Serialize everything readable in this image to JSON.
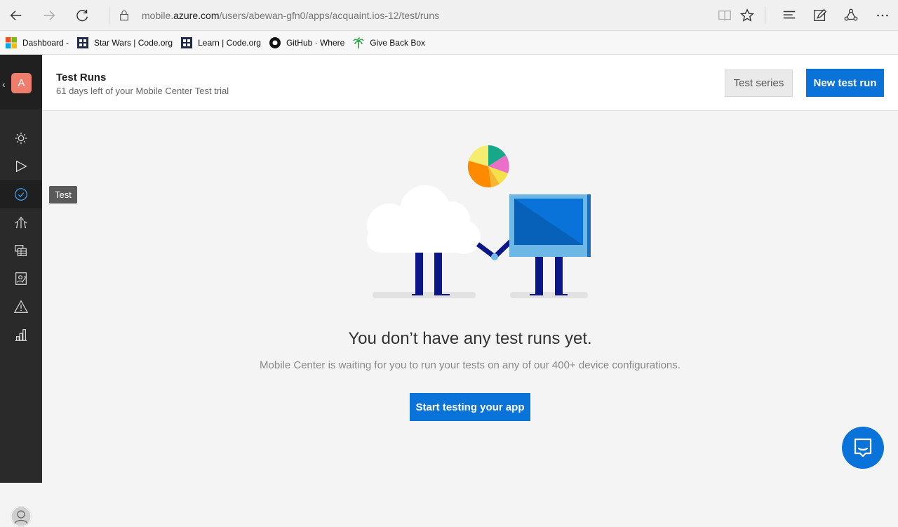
{
  "browser": {
    "url_prefix": "mobile.",
    "url_host": "azure.com",
    "url_path": "/users/abewan-gfn0/apps/acquaint.ios-12/test/runs"
  },
  "bookmarks": [
    {
      "label": "Dashboard -",
      "icon": "windows-logo-icon"
    },
    {
      "label": "Star Wars | Code.org",
      "icon": "codeorg-icon"
    },
    {
      "label": "Learn | Code.org",
      "icon": "codeorg-icon"
    },
    {
      "label": "GitHub · Where",
      "icon": "github-icon"
    },
    {
      "label": "Give Back Box",
      "icon": "palm-tree-icon"
    }
  ],
  "sidebar": {
    "app_avatar_letter": "A",
    "tooltip": "Test"
  },
  "header": {
    "title": "Test Runs",
    "subtitle": "61 days left of your Mobile Center Test trial",
    "test_series_label": "Test series",
    "new_test_run_label": "New test run"
  },
  "empty_state": {
    "title": "You don’t have any test runs yet.",
    "subtitle": "Mobile Center is waiting for you to run your tests on any of our 400+ device configurations.",
    "button_label": "Start testing your app"
  },
  "colors": {
    "accent": "#0a73d9",
    "rail": "#2a2a2a",
    "avatar": "#ef7d6b"
  }
}
